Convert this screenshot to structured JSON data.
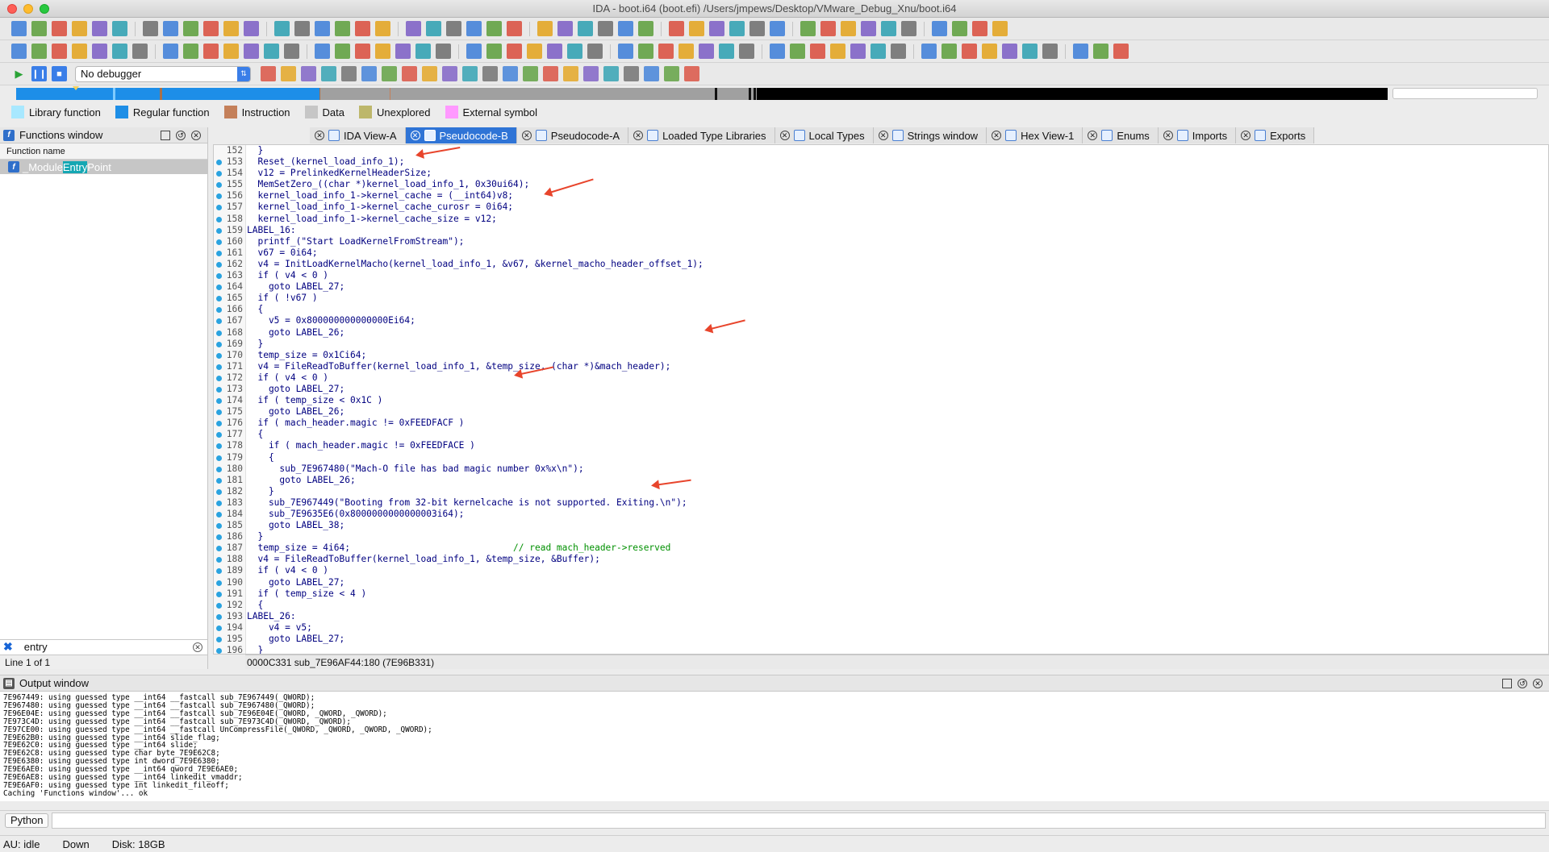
{
  "window": {
    "title": "IDA - boot.i64 (boot.efi) /Users/jmpews/Desktop/VMware_Debug_Xnu/boot.i64"
  },
  "debugger": {
    "selected": "No debugger"
  },
  "legend": [
    {
      "label": "Library function",
      "color": "#a8e8ff"
    },
    {
      "label": "Regular function",
      "color": "#1e8ee6"
    },
    {
      "label": "Instruction",
      "color": "#c4805a"
    },
    {
      "label": "Data",
      "color": "#c6c6c6"
    },
    {
      "label": "Unexplored",
      "color": "#bdb76b"
    },
    {
      "label": "External symbol",
      "color": "#ff99ff"
    }
  ],
  "functions_window": {
    "title": "Functions window",
    "column_header": "Function name",
    "items": [
      {
        "prefix": "_Module",
        "match": "Entry",
        "suffix": "Point"
      }
    ],
    "filter_text": "entry",
    "status": "Line 1 of 1"
  },
  "tabs": [
    {
      "label": "IDA View-A",
      "active": false
    },
    {
      "label": "Pseudocode-B",
      "active": true
    },
    {
      "label": "Pseudocode-A",
      "active": false
    },
    {
      "label": "Loaded Type Libraries",
      "active": false
    },
    {
      "label": "Local Types",
      "active": false
    },
    {
      "label": "Strings window",
      "active": false
    },
    {
      "label": "Hex View-1",
      "active": false
    },
    {
      "label": "Enums",
      "active": false
    },
    {
      "label": "Imports",
      "active": false
    },
    {
      "label": "Exports",
      "active": false
    }
  ],
  "code": [
    {
      "ln": "152",
      "text": "  }"
    },
    {
      "ln": "153",
      "text": "  Reset_(kernel_load_info_1);"
    },
    {
      "ln": "154",
      "text": "  v12 = PrelinkedKernelHeaderSize;"
    },
    {
      "ln": "155",
      "text": "  MemSetZero_((char *)kernel_load_info_1, 0x30ui64);"
    },
    {
      "ln": "156",
      "text": "  kernel_load_info_1->kernel_cache = (__int64)v8;"
    },
    {
      "ln": "157",
      "text": "  kernel_load_info_1->kernel_cache_curosr = 0i64;"
    },
    {
      "ln": "158",
      "text": "  kernel_load_info_1->kernel_cache_size = v12;"
    },
    {
      "ln": "159",
      "text": "LABEL_16:"
    },
    {
      "ln": "160",
      "text": "  printf_(\"Start LoadKernelFromStream\");"
    },
    {
      "ln": "161",
      "text": "  v67 = 0i64;"
    },
    {
      "ln": "162",
      "text": "  v4 = InitLoadKernelMacho(kernel_load_info_1, &v67, &kernel_macho_header_offset_1);"
    },
    {
      "ln": "163",
      "text": "  if ( v4 < 0 )"
    },
    {
      "ln": "164",
      "text": "    goto LABEL_27;"
    },
    {
      "ln": "165",
      "text": "  if ( !v67 )"
    },
    {
      "ln": "166",
      "text": "  {"
    },
    {
      "ln": "167",
      "text": "    v5 = 0x800000000000000Ei64;"
    },
    {
      "ln": "168",
      "text": "    goto LABEL_26;"
    },
    {
      "ln": "169",
      "text": "  }"
    },
    {
      "ln": "170",
      "text": "  temp_size = 0x1Ci64;"
    },
    {
      "ln": "171",
      "text": "  v4 = FileReadToBuffer(kernel_load_info_1, &temp_size, (char *)&mach_header);"
    },
    {
      "ln": "172",
      "text": "  if ( v4 < 0 )"
    },
    {
      "ln": "173",
      "text": "    goto LABEL_27;"
    },
    {
      "ln": "174",
      "text": "  if ( temp_size < 0x1C )"
    },
    {
      "ln": "175",
      "text": "    goto LABEL_26;"
    },
    {
      "ln": "176",
      "text": "  if ( mach_header.magic != 0xFEEDFACF )"
    },
    {
      "ln": "177",
      "text": "  {"
    },
    {
      "ln": "178",
      "text": "    if ( mach_header.magic != 0xFEEDFACE )"
    },
    {
      "ln": "179",
      "text": "    {"
    },
    {
      "ln": "180",
      "text": "      sub_7E967480(\"Mach-O file has bad magic number 0x%x\\n\");"
    },
    {
      "ln": "181",
      "text": "      goto LABEL_26;"
    },
    {
      "ln": "182",
      "text": "    }"
    },
    {
      "ln": "183",
      "text": "    sub_7E967449(\"Booting from 32-bit kernelcache is not supported. Exiting.\\n\");"
    },
    {
      "ln": "184",
      "text": "    sub_7E9635E6(0x8000000000000003i64);"
    },
    {
      "ln": "185",
      "text": "    goto LABEL_38;"
    },
    {
      "ln": "186",
      "text": "  }"
    },
    {
      "ln": "187",
      "text": "  temp_size = 4i64;                              // read mach_header->reserved"
    },
    {
      "ln": "188",
      "text": "  v4 = FileReadToBuffer(kernel_load_info_1, &temp_size, &Buffer);"
    },
    {
      "ln": "189",
      "text": "  if ( v4 < 0 )"
    },
    {
      "ln": "190",
      "text": "    goto LABEL_27;"
    },
    {
      "ln": "191",
      "text": "  if ( temp_size < 4 )"
    },
    {
      "ln": "192",
      "text": "  {"
    },
    {
      "ln": "193",
      "text": "LABEL_26:"
    },
    {
      "ln": "194",
      "text": "    v4 = v5;"
    },
    {
      "ln": "195",
      "text": "    goto LABEL_27;"
    },
    {
      "ln": "196",
      "text": "  }"
    }
  ],
  "code_status": "0000C331 sub_7E96AF44:180 (7E96B331)",
  "output_window": {
    "title": "Output window",
    "lines": [
      "7E967449: using guessed type __int64 __fastcall sub_7E967449(_QWORD);",
      "7E967480: using guessed type __int64 __fastcall sub_7E967480(_QWORD);",
      "7E96E04E: using guessed type __int64 __fastcall sub_7E96E04E(_QWORD, _QWORD, _QWORD);",
      "7E973C4D: using guessed type __int64 __fastcall sub_7E973C4D(_QWORD, _QWORD);",
      "7E97CE00: using guessed type __int64 __fastcall UnCompressFile(_QWORD, _QWORD, _QWORD, _QWORD);",
      "7E9E62B0: using guessed type __int64 slide_flag;",
      "7E9E62C0: using guessed type __int64 slide;",
      "7E9E62C8: using guessed type char byte_7E9E62C8;",
      "7E9E6380: using guessed type int dword_7E9E6380;",
      "7E9E6AE0: using guessed type __int64 qword_7E9E6AE0;",
      "7E9E6AE8: using guessed type __int64 linkedit_vmaddr;",
      "7E9E6AF0: using guessed type int linkedit_fileoff;",
      "Caching 'Functions window'... ok"
    ]
  },
  "python_button": "Python",
  "status_bar": {
    "au": "AU:  idle",
    "direction": "Down",
    "disk": "Disk: 18GB"
  }
}
